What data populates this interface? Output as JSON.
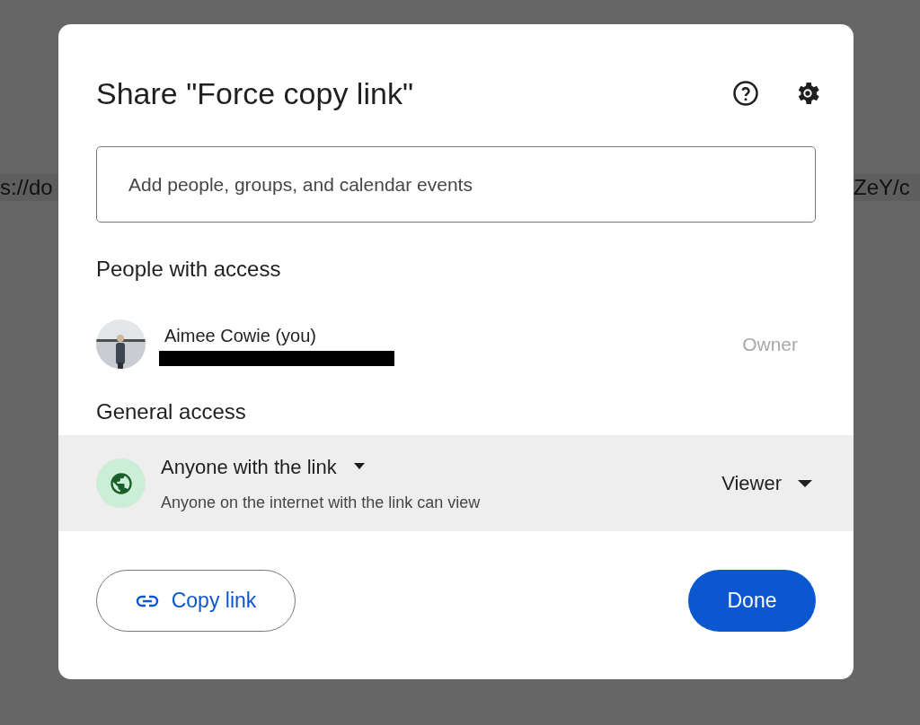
{
  "background": {
    "url_left": "s://do",
    "url_right": "ZeY/c"
  },
  "dialog": {
    "title": "Share \"Force copy link\"",
    "search": {
      "placeholder": "Add people, groups, and calendar events"
    },
    "people_heading": "People with access",
    "people": [
      {
        "name": "Aimee Cowie (you)",
        "email_redacted": true,
        "role": "Owner"
      }
    ],
    "general_heading": "General access",
    "general": {
      "scope": "Anyone with the link",
      "description": "Anyone on the internet with the link can view",
      "role": "Viewer"
    },
    "copy_button": "Copy link",
    "done_button": "Done"
  }
}
